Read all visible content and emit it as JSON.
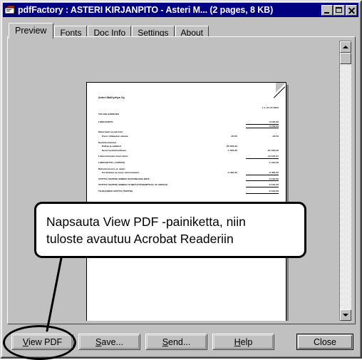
{
  "window": {
    "title": "pdfFactory : ASTERI KIRJANPITO - Asteri M... (2 pages, 8 KB)",
    "icon": "pdffactory-app-icon",
    "controls": {
      "minimize": "Minimize",
      "maximize": "Maximize",
      "close": "Close"
    }
  },
  "tabs": [
    {
      "label": "Preview",
      "active": true
    },
    {
      "label": "Fonts",
      "active": false
    },
    {
      "label": "Doc Info",
      "active": false
    },
    {
      "label": "Settings",
      "active": false
    },
    {
      "label": "About",
      "active": false
    }
  ],
  "preview": {
    "scrollbar": {
      "up_arrow": "scroll-up-arrow",
      "down_arrow": "scroll-down-arrow",
      "thumb": "scroll-thumb"
    },
    "document": {
      "company": "Asteri Malliyritys Oy",
      "period": "1.1.-31.12.2003",
      "heading": "TULOSLASKELMA",
      "rows": [
        {
          "label": "LIIKEVAIHTO",
          "c1": "",
          "c2": "3 730,00",
          "indent": 0,
          "rule": "c2"
        },
        {
          "label": "",
          "c1": "",
          "c2": "3 730,00",
          "indent": 0,
          "rule": "c2"
        },
        {
          "label": "Materiaalit ja palvelut",
          "c1": "",
          "c2": "",
          "indent": 0,
          "rule": ""
        },
        {
          "label": "Ostot tilikauden aikana",
          "c1": "-22,50",
          "c2": "-22,50",
          "indent": 1,
          "rule": ""
        },
        {
          "label": "Henkilöstökulut",
          "c1": "",
          "c2": "",
          "indent": 0,
          "rule": ""
        },
        {
          "label": "Palkat ja palkkiot",
          "c1": "-80 000,00",
          "c2": "",
          "indent": 1,
          "rule": ""
        },
        {
          "label": "Sivut henkilöstökulut",
          "c1": "-1 540,00",
          "c2": "-81 540,00",
          "indent": 1,
          "rule": ""
        },
        {
          "label": "Liiketoiminnan muut kulut",
          "c1": "",
          "c2": "-12 150,31",
          "indent": 0,
          "rule": "c2"
        },
        {
          "label": "LIIKEVOITTO (-TAPPIO)",
          "c1": "",
          "c2": "-1 734,50",
          "indent": 0,
          "rule": ""
        },
        {
          "label": "Rahoitustuotot ja -kulut",
          "c1": "",
          "c2": "",
          "indent": 0,
          "rule": ""
        },
        {
          "label": "Korkokulut ja muut rahoituskulut",
          "c1": "-3 400,00",
          "c2": "-3 400,00",
          "indent": 1,
          "rule": "c2"
        },
        {
          "label": "VOITTO (TAPPIO) ENNEN SATUNNAISIA ERIÄ",
          "c1": "",
          "c2": "-5 134,50",
          "indent": 0,
          "rule": "c2"
        },
        {
          "label": "VOITTO (TAPPIO) ENNEN TILINPÄÄTÖSSIIRTOJA JA VEROJA",
          "c1": "",
          "c2": "-5 134,50",
          "indent": 0,
          "rule": "c2"
        },
        {
          "label": "TILIKAUDEN VOITTO (TAPPIO)",
          "c1": "",
          "c2": "-5 134,50",
          "indent": 0,
          "rule": "thick"
        }
      ]
    }
  },
  "callout": {
    "text": "Napsauta View PDF -painiketta, niin\ntuloste avautuu Acrobat Readeriin",
    "highlight_target": "View PDF"
  },
  "buttons": {
    "view_pdf": {
      "pre": "",
      "acc": "V",
      "post": "iew PDF"
    },
    "save": {
      "pre": "",
      "acc": "S",
      "post": "ave..."
    },
    "send": {
      "pre": "",
      "acc": "S",
      "post": "end..."
    },
    "help": {
      "pre": "",
      "acc": "H",
      "post": "elp"
    },
    "close": {
      "pre": "",
      "acc": "",
      "post": "Close"
    }
  }
}
